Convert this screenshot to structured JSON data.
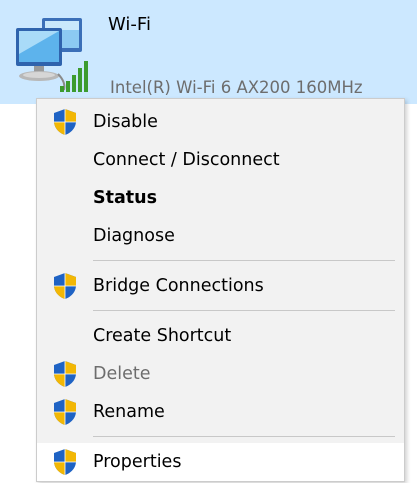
{
  "adapter": {
    "name": "Wi-Fi",
    "description": "Intel(R) Wi-Fi 6 AX200 160MHz",
    "icon": "network-adapter-wifi-icon"
  },
  "menu": {
    "items": [
      {
        "label": "Disable",
        "shield": true,
        "bold": false,
        "disabled": false
      },
      {
        "label": "Connect / Disconnect",
        "shield": false,
        "bold": false,
        "disabled": false
      },
      {
        "label": "Status",
        "shield": false,
        "bold": true,
        "disabled": false
      },
      {
        "label": "Diagnose",
        "shield": false,
        "bold": false,
        "disabled": false
      },
      {
        "label": "Bridge Connections",
        "shield": true,
        "bold": false,
        "disabled": false
      },
      {
        "label": "Create Shortcut",
        "shield": false,
        "bold": false,
        "disabled": false
      },
      {
        "label": "Delete",
        "shield": true,
        "bold": false,
        "disabled": true
      },
      {
        "label": "Rename",
        "shield": true,
        "bold": false,
        "disabled": false
      },
      {
        "label": "Properties",
        "shield": true,
        "bold": false,
        "disabled": false
      }
    ],
    "highlighted": "Properties"
  },
  "colors": {
    "selection": "#cce8ff",
    "menu_background": "#f2f2f2",
    "hover": "#ffffff",
    "disabled_text": "#6d6d6d",
    "shield_blue": "#1f63c4",
    "shield_gold": "#f2b705"
  }
}
